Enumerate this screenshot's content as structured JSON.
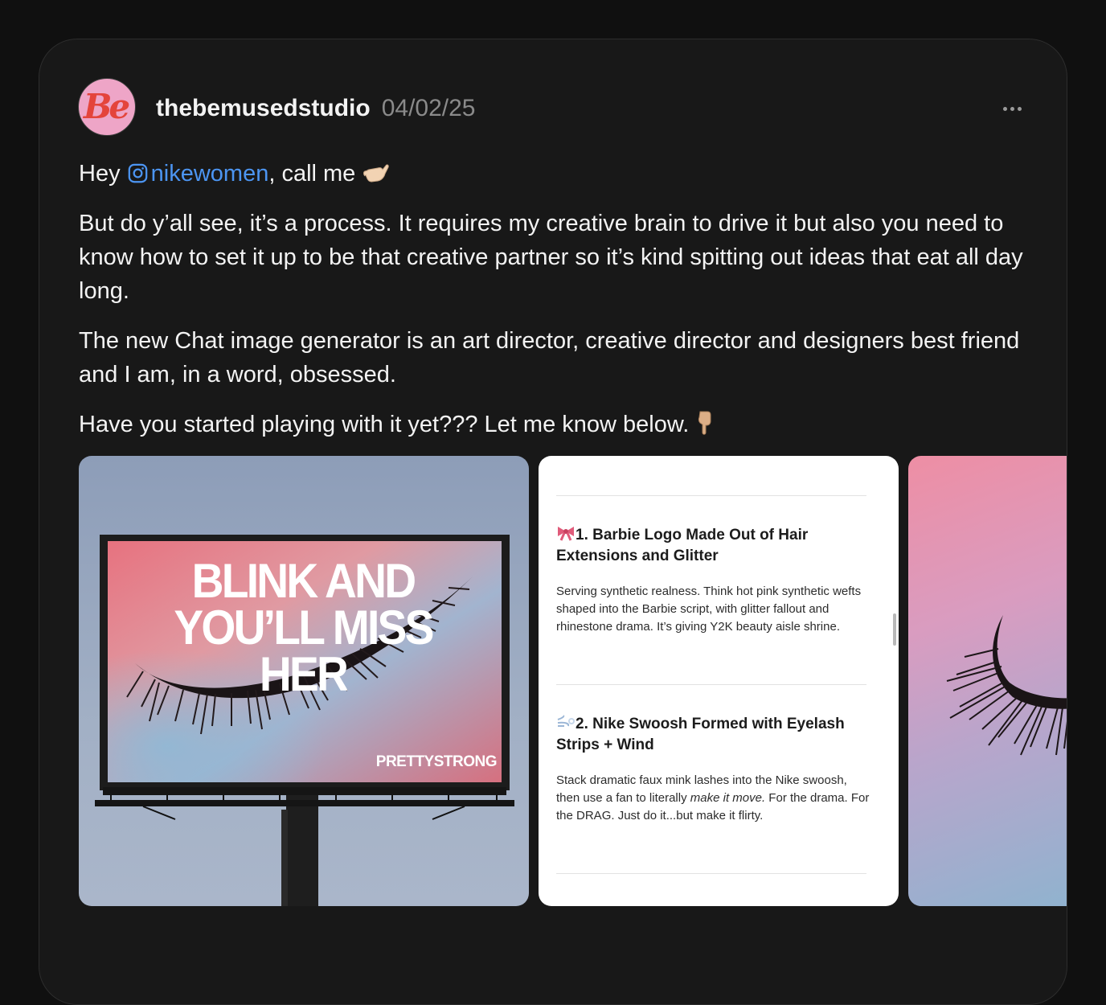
{
  "post": {
    "avatar_text": "Be",
    "username": "thebemusedstudio",
    "date": "04/02/25",
    "greeting_prefix": "Hey ",
    "mention": "nikewomen",
    "greeting_suffix": ", call me",
    "paragraphs": [
      "But do y’all see, it’s a process. It requires my creative brain to drive it but also you need to know how to set it up to be that creative partner so it’s kind spitting out ideas that eat all day long.",
      "The new Chat image generator is an art director, creative director and designers best friend and I am, in a word, obsessed.",
      "Have you started playing with it yet??? Let me know below."
    ]
  },
  "carousel": {
    "billboard": {
      "headline": "BLINK AND\nYOU’LL MISS HER",
      "brand": "PRETTYSTRONG"
    },
    "ideas": [
      {
        "title": "1. Barbie Logo Made Out of Hair Extensions and Glitter",
        "icon": "ribbon-icon",
        "body": "Serving synthetic realness. Think hot pink synthetic wefts shaped into the Barbie script, with glitter fallout and rhinestone drama. It’s giving Y2K beauty aisle shrine."
      },
      {
        "title": "2. Nike Swoosh Formed with Eyelash Strips + Wind",
        "icon": "wind-icon",
        "body_before": "Stack dramatic faux mink lashes into the Nike swoosh, then use a fan to literally ",
        "body_emphasis": "make it move.",
        "body_after": " For the drama. For the DRAG. Just do it...but make it flirty."
      }
    ]
  },
  "colors": {
    "background": "#101010",
    "card": "#181818",
    "mention": "#4c95f2",
    "muted": "#8a8a8a",
    "avatar_bg": "#eea5c7",
    "avatar_text": "#e4443b"
  }
}
